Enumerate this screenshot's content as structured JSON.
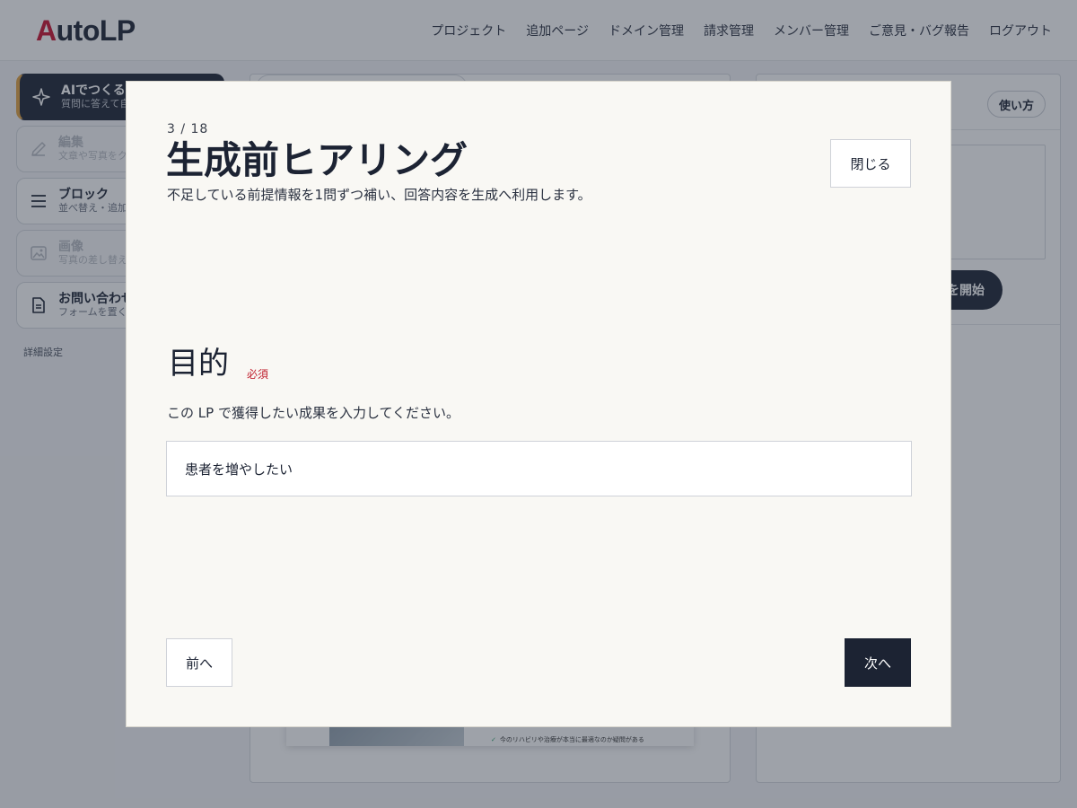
{
  "app": {
    "logo_prefix": "A",
    "logo_rest": "utoLP"
  },
  "nav": {
    "items": [
      {
        "label": "プロジェクト"
      },
      {
        "label": "追加ページ"
      },
      {
        "label": "ドメイン管理"
      },
      {
        "label": "請求管理"
      },
      {
        "label": "メンバー管理"
      },
      {
        "label": "ご意見・バグ報告"
      },
      {
        "label": "ログアウト"
      }
    ]
  },
  "sidebar": {
    "items": [
      {
        "title": "AIでつくる",
        "sub": "質問に答えて自",
        "icon": "sparkle-icon",
        "state": "active"
      },
      {
        "title": "編集",
        "sub": "文章や写真をク",
        "icon": "pencil-icon",
        "state": "disabled"
      },
      {
        "title": "ブロック",
        "sub": "並べ替え・追加",
        "icon": "list-icon",
        "state": "normal"
      },
      {
        "title": "画像",
        "sub": "写真の差し替え",
        "icon": "image-icon",
        "state": "disabled"
      },
      {
        "title": "お問い合わせ",
        "sub": "フォームを置く",
        "icon": "document-icon",
        "state": "normal"
      }
    ],
    "advanced_link": "詳細設定"
  },
  "preview": {
    "check_line": "今のリハビリや治療が本当に最適なのか疑問がある"
  },
  "right_panel": {
    "howto_label": "使い方",
    "start_label": "を開始"
  },
  "modal": {
    "step": "3 / 18",
    "title": "生成前ヒアリング",
    "description": "不足している前提情報を1問ずつ補い、回答内容を生成へ利用します。",
    "close_label": "閉じる",
    "question": {
      "label": "目的",
      "required_badge": "必須",
      "help": "この LP で獲得したい成果を入力してください。",
      "value": "患者を増やしたい"
    },
    "prev_label": "前へ",
    "next_label": "次へ"
  },
  "colors": {
    "primary_dark": "#1c2333",
    "logo_accent": "#c8102e",
    "required_red": "#c0202e",
    "active_accent": "#e0a040",
    "modal_bg": "#f9f8f4"
  }
}
